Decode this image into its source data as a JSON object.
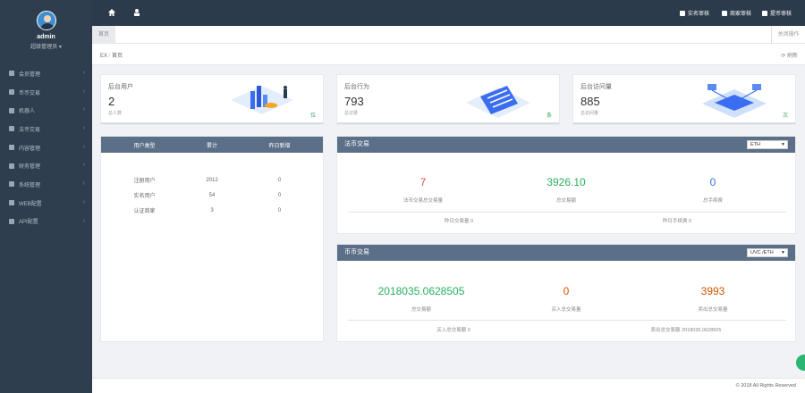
{
  "user": {
    "name": "admin",
    "role": "超级管理员 ▾"
  },
  "sidebar": {
    "items": [
      {
        "label": "会员管理"
      },
      {
        "label": "币币交易"
      },
      {
        "label": "机器人"
      },
      {
        "label": "法币交易"
      },
      {
        "label": "内容管理"
      },
      {
        "label": "财务管理"
      },
      {
        "label": "系统管理"
      },
      {
        "label": "WEB配置"
      },
      {
        "label": "API配置"
      }
    ]
  },
  "topbar": {
    "home_icon": "home-icon",
    "user_icon": "user-icon",
    "links": [
      "实名审核",
      "商家审核",
      "提币审核"
    ]
  },
  "tabs": {
    "active": "首页",
    "close_ops": "关闭操作"
  },
  "breadcrumb": {
    "root": "EX",
    "sep": "/",
    "current": "首页",
    "refresh": "刷新"
  },
  "stats": [
    {
      "label": "后台用户",
      "value": "2",
      "sub": "总人数",
      "unit": "位"
    },
    {
      "label": "后台行为",
      "value": "793",
      "sub": "总记录",
      "unit": "条"
    },
    {
      "label": "后台访问量",
      "value": "885",
      "sub": "总访问量",
      "unit": "次"
    }
  ],
  "user_table": {
    "headers": [
      "用户类型",
      "累计",
      "昨日新增"
    ],
    "rows": [
      [
        "注册用户",
        "2012",
        "0"
      ],
      [
        "实名用户",
        "54",
        "0"
      ],
      [
        "认证商家",
        "3",
        "0"
      ]
    ]
  },
  "fiat": {
    "title": "法币交易",
    "select": "ETH",
    "metrics": [
      {
        "value": "7",
        "caption": "法币交易总交易量",
        "color": "#d9534f"
      },
      {
        "value": "3926.10",
        "caption": "总交易额",
        "color": "#27ae60"
      },
      {
        "value": "0",
        "caption": "总手续费",
        "color": "#2a7ae2"
      }
    ],
    "footer": [
      "昨日交易量 0",
      "昨日手续费 0"
    ]
  },
  "coin": {
    "title": "币币交易",
    "select": "UVC /ETH",
    "metrics": [
      {
        "value": "2018035.0628505",
        "caption": "总交易额",
        "color": "#27ae60"
      },
      {
        "value": "0",
        "caption": "买入总交易量",
        "color": "#d35400"
      },
      {
        "value": "3993",
        "caption": "卖出总交易量",
        "color": "#d35400"
      }
    ],
    "footer": [
      "买入总交易额 0",
      "卖出总交易额 2018035.0628505"
    ]
  },
  "footer": {
    "copyright": "© 2018 All Rights Reserved"
  }
}
